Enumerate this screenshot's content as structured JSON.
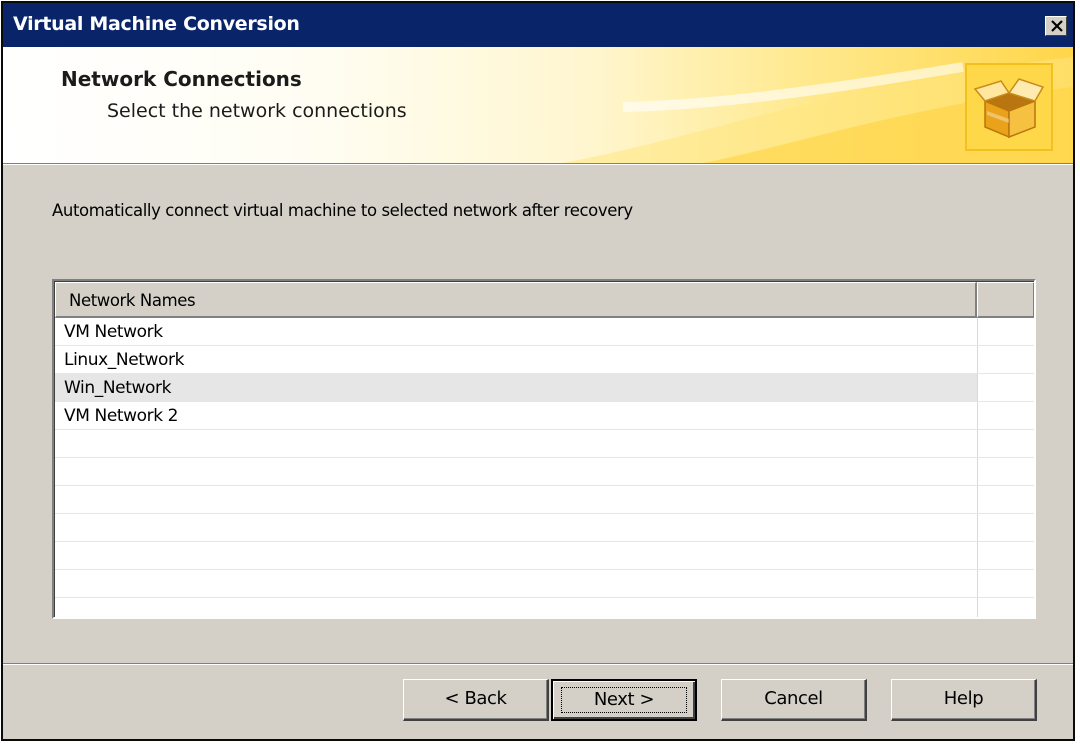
{
  "window": {
    "title": "Virtual Machine Conversion",
    "close_label": "×"
  },
  "header": {
    "title": "Network Connections",
    "subtitle": "Select the network connections",
    "icon": "open-box-icon"
  },
  "instruction": "Automatically connect virtual machine to selected network after recovery",
  "network_list": {
    "columns": [
      "Network Names",
      ""
    ],
    "rows": [
      {
        "name": "VM Network",
        "selected": false
      },
      {
        "name": "Linux_Network",
        "selected": false
      },
      {
        "name": "Win_Network",
        "selected": true
      },
      {
        "name": "VM Network 2",
        "selected": false
      },
      {
        "name": "",
        "selected": false
      },
      {
        "name": "",
        "selected": false
      },
      {
        "name": "",
        "selected": false
      },
      {
        "name": "",
        "selected": false
      },
      {
        "name": "",
        "selected": false
      },
      {
        "name": "",
        "selected": false
      }
    ]
  },
  "buttons": {
    "back": "< Back",
    "next": "Next >",
    "cancel": "Cancel",
    "help": "Help"
  },
  "colors": {
    "titlebar": "#0a246a",
    "dialog": "#d4d0c8",
    "selected_row": "#e6e6e6",
    "header_gold": "#ffd64a"
  }
}
